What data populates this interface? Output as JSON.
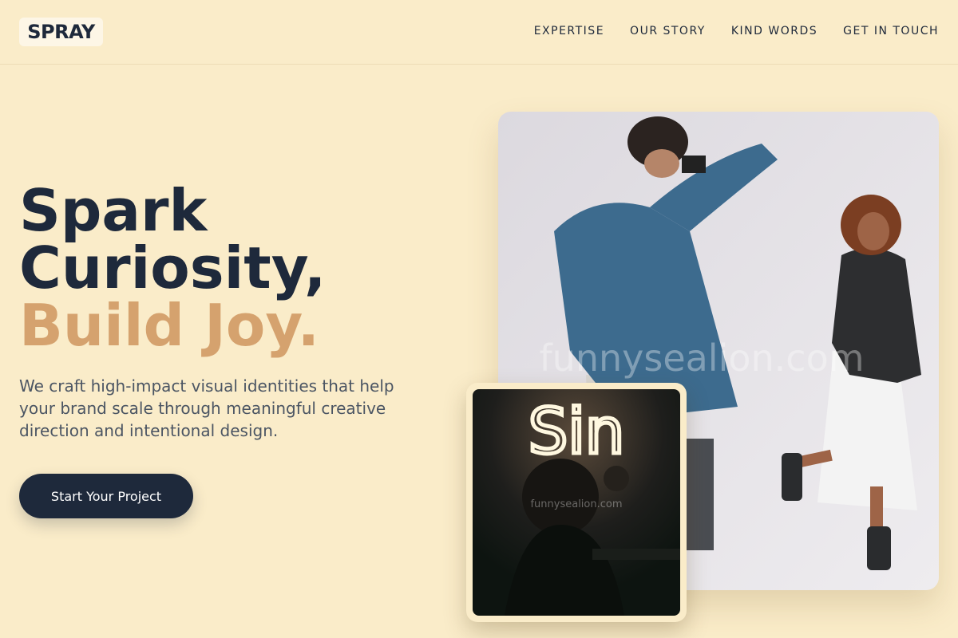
{
  "brand": {
    "logo_text": "SPRAY"
  },
  "nav": {
    "items": [
      "EXPERTISE",
      "OUR STORY",
      "KIND WORDS",
      "GET IN TOUCH"
    ]
  },
  "hero": {
    "title_line1": "Spark",
    "title_line2": "Curiosity,",
    "title_accent": "Build Joy.",
    "description": "We craft high-impact visual identities that help your brand scale through meaningful creative direction and intentional design.",
    "cta_label": "Start Your Project"
  },
  "images": {
    "main_watermark": "funnysealion.com",
    "inset_watermark": "funnysealion.com",
    "inset_neon_text": "Sin"
  },
  "colors": {
    "background": "#faecc9",
    "navy": "#1e293b",
    "accent": "#d5a26e",
    "body_text": "#4b5563"
  }
}
